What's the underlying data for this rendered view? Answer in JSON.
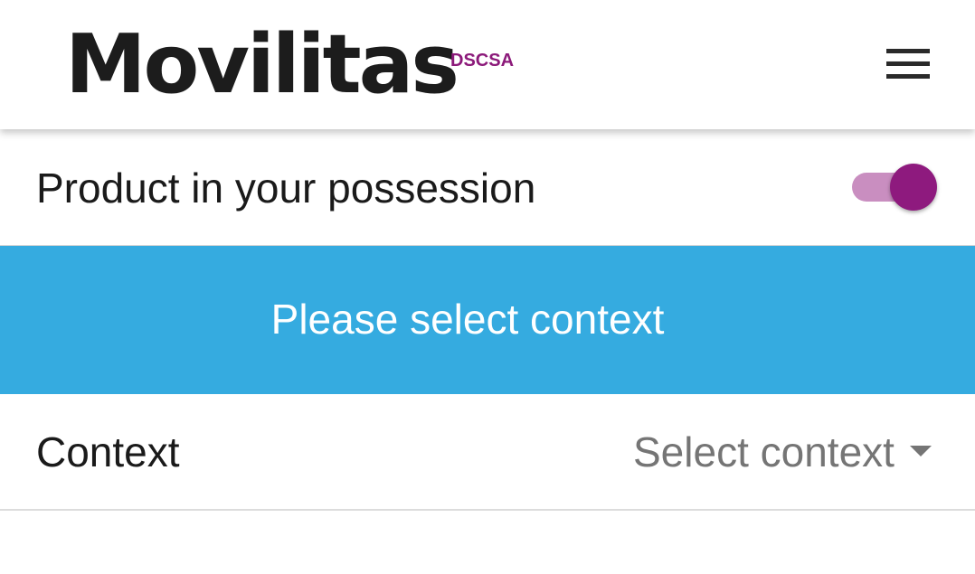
{
  "header": {
    "brand_name": "Movilitas",
    "brand_tag": "DSCSA",
    "menu_icon": "hamburger-menu-icon"
  },
  "possession": {
    "label": "Product in your possession",
    "toggle_on": true
  },
  "banner": {
    "text": "Please select context"
  },
  "context": {
    "label": "Context",
    "select_placeholder": "Select context",
    "caret_icon": "dropdown-caret-icon"
  },
  "colors": {
    "brand_tag": "#8c1a7a",
    "toggle_thumb": "#8e1a7e",
    "toggle_track": "#c98ec0",
    "banner": "#35abe0",
    "text_primary": "#1a1a1a",
    "text_secondary": "#757575"
  }
}
